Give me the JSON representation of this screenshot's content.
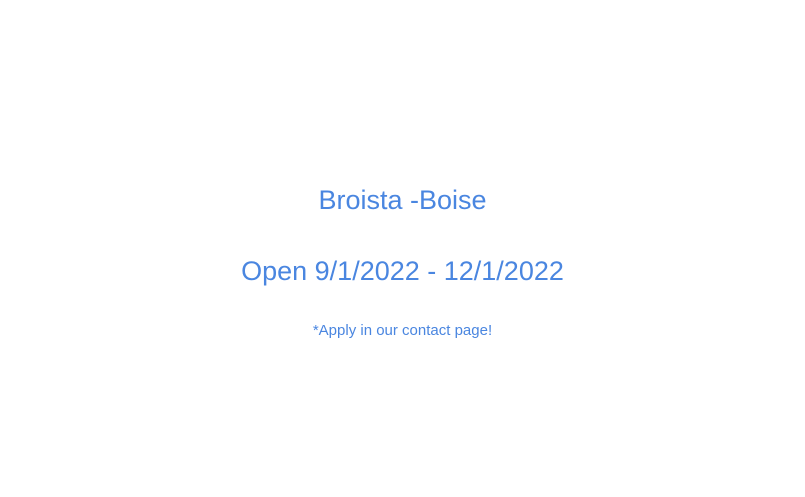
{
  "colors": {
    "background": "#ffffff",
    "accent": "#4a86e0"
  },
  "notice": {
    "title": "Broista -Boise",
    "dates": "Open 9/1/2022 - 12/1/2022",
    "note": "*Apply in our contact page!"
  }
}
